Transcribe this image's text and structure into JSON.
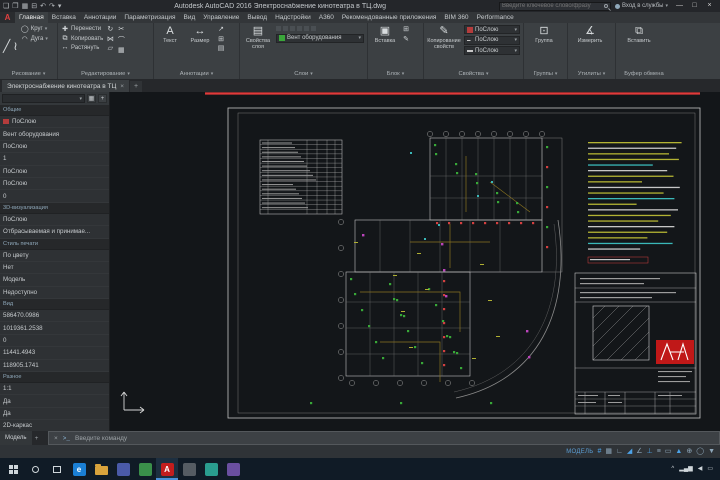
{
  "colors": {
    "accent_red": "#e03a3a",
    "canvas_bg": "#131619",
    "ribbon_bg": "#3c4043",
    "layer_green": "#3aa63a",
    "bylayer_red": "#b43c3c",
    "logo_red": "#c01818"
  },
  "title_bar": {
    "app_title": "Autodesk AutoCAD 2016   Электроснабжение кинотеатра в ТЦ.dwg",
    "search_placeholder": "Введите ключевое слово/фразу",
    "signin_label": "Вход в службы",
    "window_buttons": [
      "—",
      "□",
      "×"
    ],
    "quick_access": [
      {
        "name": "new",
        "glyph": "❏"
      },
      {
        "name": "open",
        "glyph": "❐"
      },
      {
        "name": "save",
        "glyph": "▦"
      },
      {
        "name": "plot",
        "glyph": "⊟"
      },
      {
        "name": "undo",
        "glyph": "↶"
      },
      {
        "name": "redo",
        "glyph": "↷"
      },
      {
        "name": "qat-dropdown",
        "glyph": "▾"
      }
    ]
  },
  "menu": {
    "active": "Главная",
    "app_button": "A",
    "items": [
      "Главная",
      "Вставка",
      "Аннотации",
      "Параметризация",
      "Вид",
      "Управление",
      "Вывод",
      "Надстройки",
      "A360",
      "Рекомендованные приложения",
      "BIM 360",
      "Performance"
    ]
  },
  "ribbon": {
    "panels": [
      {
        "label": "Рисование",
        "buttons": [
          "Круг",
          "Дуга"
        ]
      },
      {
        "label": "Редактирование",
        "buttons": [
          "Перенести",
          "Копировать",
          "Растянуть"
        ]
      },
      {
        "label": "Аннотации",
        "buttons": [
          "Текст",
          "Размер"
        ]
      },
      {
        "label": "Слои",
        "buttons": [
          "Свойства слоя"
        ],
        "layer_value": "Вент оборудования"
      },
      {
        "label": "Блок",
        "buttons": [
          "Вставка"
        ]
      },
      {
        "label": "Свойства",
        "buttons": [
          "Копирование свойств"
        ],
        "combos": [
          "ПоСлою",
          "ПоСлою",
          "ПоСлою"
        ]
      },
      {
        "label": "Группы",
        "buttons": [
          "Группа"
        ]
      },
      {
        "label": "Утилиты",
        "buttons": [
          "Измерить"
        ]
      },
      {
        "label": "Буфер обмена",
        "buttons": [
          "Вставить"
        ]
      }
    ]
  },
  "file_tabs": {
    "tabs": [
      {
        "label": "Электроснабжение кинотеатра в ТЦ",
        "close": "×"
      }
    ],
    "new_tab": "+"
  },
  "palette": {
    "rows": [
      {
        "type": "header",
        "text": "Общие"
      },
      {
        "type": "value",
        "text": "ПоСлою",
        "swatch": "#b43c3c"
      },
      {
        "type": "value",
        "text": "Вент оборудования"
      },
      {
        "type": "value",
        "text": "ПоСлою"
      },
      {
        "type": "value",
        "text": "1"
      },
      {
        "type": "value",
        "text": "ПоСлою"
      },
      {
        "type": "value",
        "text": "ПоСлою"
      },
      {
        "type": "value",
        "text": "0"
      },
      {
        "type": "header",
        "text": "3D-визуализация"
      },
      {
        "type": "value",
        "text": "ПоСлою"
      },
      {
        "type": "value",
        "text": "Отбрасываемая и принимае..."
      },
      {
        "type": "header",
        "text": "Стиль печати"
      },
      {
        "type": "value",
        "text": "По цвету"
      },
      {
        "type": "value",
        "text": "Нет"
      },
      {
        "type": "value",
        "text": "Модель"
      },
      {
        "type": "value",
        "text": "Недоступно"
      },
      {
        "type": "header",
        "text": "Вид"
      },
      {
        "type": "value",
        "text": "586470.0986"
      },
      {
        "type": "value",
        "text": "1019361.2538"
      },
      {
        "type": "value",
        "text": "0"
      },
      {
        "type": "value",
        "text": "11441.4943"
      },
      {
        "type": "value",
        "text": "118905.1741"
      },
      {
        "type": "header",
        "text": "Разное"
      },
      {
        "type": "value",
        "text": "1:1"
      },
      {
        "type": "value",
        "text": "Да"
      },
      {
        "type": "value",
        "text": "Да"
      },
      {
        "type": "value",
        "text": "2D-каркас"
      }
    ]
  },
  "layout_tabs": {
    "model": "Модель",
    "new": "+"
  },
  "command_line": {
    "close": "×",
    "prompt": ">_",
    "placeholder": "Введите команду"
  },
  "status_bar": {
    "model_label": "МОДЕЛЬ",
    "icons": [
      {
        "name": "grid",
        "glyph": "#",
        "color": "#4da3e8"
      },
      {
        "name": "snap",
        "glyph": "▦",
        "color": "#8fa8bb"
      },
      {
        "name": "ortho",
        "glyph": "∟",
        "color": "#8fa8bb"
      },
      {
        "name": "polar",
        "glyph": "◢",
        "color": "#4da3e8"
      },
      {
        "name": "isodraft",
        "glyph": "∠",
        "color": "#8fa8bb"
      },
      {
        "name": "osnap",
        "glyph": "⊥",
        "color": "#4da3e8"
      },
      {
        "name": "lineweight",
        "glyph": "≡",
        "color": "#8fa8bb"
      },
      {
        "name": "transparency",
        "glyph": "▭",
        "color": "#8fa8bb"
      },
      {
        "name": "annotation-scale",
        "glyph": "▲",
        "color": "#4da3e8"
      },
      {
        "name": "workspace",
        "glyph": "⊕",
        "color": "#8fa8bb"
      },
      {
        "name": "isolate",
        "glyph": "◯",
        "color": "#8fa8bb"
      },
      {
        "name": "expand",
        "glyph": "▼",
        "color": "#8fa8bb"
      }
    ]
  },
  "taskbar": {
    "apps": [
      {
        "name": "edge-browser",
        "color": "#1b7fd4",
        "label": "e"
      },
      {
        "name": "file-explorer",
        "color": "#d9a33c",
        "folder": true
      },
      {
        "name": "app-blue",
        "color": "#4a5aa8",
        "label": ""
      },
      {
        "name": "app-green",
        "color": "#3a8f4a",
        "label": ""
      },
      {
        "name": "autocad",
        "color": "#c21d1d",
        "label": "A",
        "active": true
      },
      {
        "name": "app-grey",
        "color": "#555c63",
        "label": ""
      },
      {
        "name": "app-teal",
        "color": "#2a9d8f",
        "label": ""
      },
      {
        "name": "app-purple",
        "color": "#6a4fa0",
        "label": ""
      }
    ],
    "tray": [
      {
        "name": "chevron-up",
        "glyph": "^"
      },
      {
        "name": "network",
        "glyph": "▂▄▆"
      },
      {
        "name": "volume",
        "glyph": "◀"
      },
      {
        "name": "notifications",
        "glyph": "▭"
      }
    ]
  }
}
